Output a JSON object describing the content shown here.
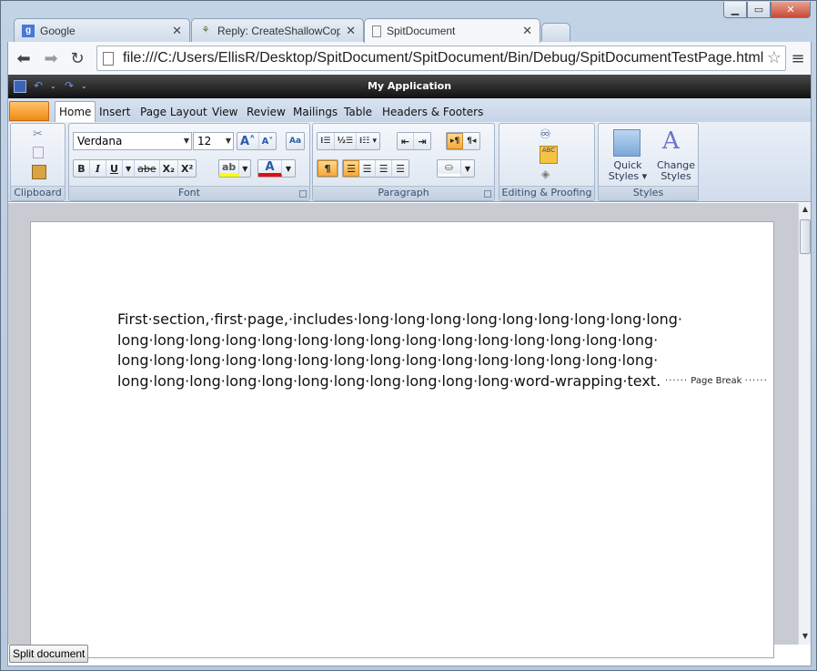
{
  "browser": {
    "tabs": [
      {
        "title": "Google",
        "icon": "google-g-icon"
      },
      {
        "title": "Reply: CreateShallowCopy",
        "icon": "puzzle-icon"
      },
      {
        "title": "SpitDocument",
        "icon": "page-icon"
      }
    ],
    "active_tab": 2,
    "url": "file:///C:/Users/EllisR/Desktop/SpitDocument/SpitDocument/Bin/Debug/SpitDocumentTestPage.html"
  },
  "app": {
    "title": "My Application",
    "ribbon_tabs": [
      "Home",
      "Insert",
      "Page Layout",
      "View",
      "Review",
      "Mailings",
      "Table",
      "Headers & Footers"
    ],
    "active_ribbon_tab": "Home",
    "groups": {
      "clipboard": "Clipboard",
      "font": "Font",
      "paragraph": "Paragraph",
      "editing": "Editing & Proofing",
      "styles": "Styles"
    },
    "font_name": "Verdana",
    "font_size": "12",
    "font_buttons": {
      "bold": "B",
      "italic": "I",
      "underline": "U",
      "strike": "abe",
      "subscript": "X₂",
      "superscript": "X²"
    },
    "styles_buttons": {
      "quick": "Quick Styles",
      "quick_line1": "Quick",
      "quick_line2": "Styles",
      "change_line1": "Change",
      "change_line2": "Styles"
    }
  },
  "document": {
    "lines": [
      "First·section,·first·page,·includes·long·long·long·long·long·long·long·long·long·",
      "long·long·long·long·long·long·long·long·long·long·long·long·long·long·long·",
      "long·long·long·long·long·long·long·long·long·long·long·long·long·long·long·",
      "long·long·long·long·long·long·long·long·long·long·long·word-wrapping·text."
    ],
    "page_break_label": "Page Break"
  },
  "footer": {
    "split_button": "Split document"
  },
  "colors": {
    "accent_orange": "#f6a939",
    "app_bar": "#1a1a1a",
    "ribbon_bg": "#dbe4f0"
  }
}
